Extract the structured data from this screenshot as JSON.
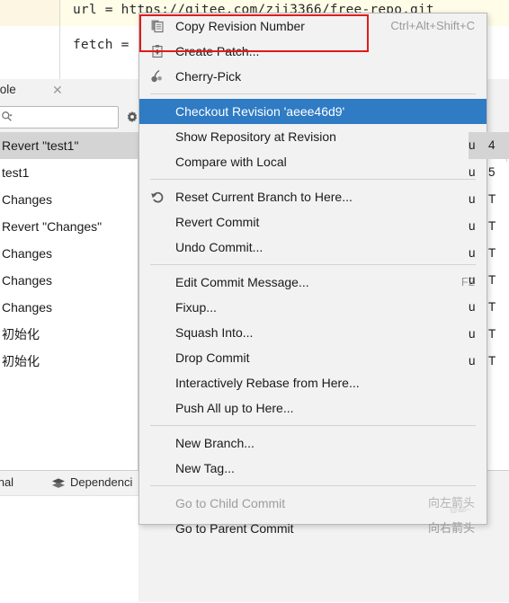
{
  "editor": {
    "line1": "url = https://gitee.com/zjj3366/free-repo.git",
    "line2": "fetch = ",
    "line2_tail": "'*"
  },
  "tool_window": {
    "tab_label": "onsole",
    "close_icon": "close-icon",
    "search": {
      "placeholder": "",
      "value": "",
      "icon": "search-icon"
    },
    "settings_icon": "gear-icon",
    "commits": [
      {
        "subject": "Revert \"test1\"",
        "selected": true
      },
      {
        "subject": "test1",
        "selected": false
      },
      {
        "subject": "Changes",
        "selected": false
      },
      {
        "subject": "Revert \"Changes\"",
        "selected": false
      },
      {
        "subject": "Changes",
        "selected": false
      },
      {
        "subject": "Changes",
        "selected": false
      },
      {
        "subject": "Changes",
        "selected": false
      },
      {
        "subject": "初始化",
        "selected": false
      },
      {
        "subject": "初始化",
        "selected": false
      }
    ],
    "right_columns": [
      {
        "author": "u",
        "date": "4",
        "selected": true
      },
      {
        "author": "u",
        "date": "5",
        "selected": false
      },
      {
        "author": "u",
        "date": "T",
        "selected": false
      },
      {
        "author": "u",
        "date": "T",
        "selected": false
      },
      {
        "author": "u",
        "date": "T",
        "selected": false
      },
      {
        "author": "u",
        "date": "T",
        "selected": false
      },
      {
        "author": "u",
        "date": "T",
        "selected": false
      },
      {
        "author": "u",
        "date": "T",
        "selected": false
      },
      {
        "author": "u",
        "date": "T",
        "selected": false
      }
    ],
    "sort_icon": "sort-arrows-icon"
  },
  "status_bar": {
    "terminal_label": "minal",
    "dependencies_label": "Dependenci",
    "dependencies_icon": "layers-icon"
  },
  "context_menu": {
    "groups": [
      {
        "items": [
          {
            "label": "Copy Revision Number",
            "accel": "Ctrl+Alt+Shift+C",
            "icon": "copy-icon",
            "state": "normal",
            "highlighted_box": true
          },
          {
            "label": "Create Patch...",
            "accel": "",
            "icon": "patch-icon",
            "state": "normal"
          },
          {
            "label": "Cherry-Pick",
            "accel": "",
            "icon": "cherry-icon",
            "state": "normal"
          }
        ]
      },
      {
        "items": [
          {
            "label": "Checkout Revision 'aeee46d9'",
            "accel": "",
            "icon": "",
            "state": "selected"
          },
          {
            "label": "Show Repository at Revision",
            "accel": "",
            "icon": "",
            "state": "normal"
          },
          {
            "label": "Compare with Local",
            "accel": "",
            "icon": "",
            "state": "normal"
          }
        ]
      },
      {
        "items": [
          {
            "label": "Reset Current Branch to Here...",
            "accel": "",
            "icon": "undo-icon",
            "state": "normal"
          },
          {
            "label": "Revert Commit",
            "accel": "",
            "icon": "",
            "state": "normal"
          },
          {
            "label": "Undo Commit...",
            "accel": "",
            "icon": "",
            "state": "normal"
          }
        ]
      },
      {
        "items": [
          {
            "label": "Edit Commit Message...",
            "accel": "F2",
            "icon": "",
            "state": "normal"
          },
          {
            "label": "Fixup...",
            "accel": "",
            "icon": "",
            "state": "normal"
          },
          {
            "label": "Squash Into...",
            "accel": "",
            "icon": "",
            "state": "normal"
          },
          {
            "label": "Drop Commit",
            "accel": "",
            "icon": "",
            "state": "normal"
          },
          {
            "label": "Interactively Rebase from Here...",
            "accel": "",
            "icon": "",
            "state": "normal"
          },
          {
            "label": "Push All up to Here...",
            "accel": "",
            "icon": "",
            "state": "normal"
          }
        ]
      },
      {
        "items": [
          {
            "label": "New Branch...",
            "accel": "",
            "icon": "",
            "state": "normal"
          },
          {
            "label": "New Tag...",
            "accel": "",
            "icon": "",
            "state": "normal"
          }
        ]
      },
      {
        "items": [
          {
            "label": "Go to Child Commit",
            "accel": "向左箭头",
            "icon": "",
            "state": "disabled"
          },
          {
            "label": "Go to Parent Commit",
            "accel": "向右箭头",
            "icon": "",
            "state": "normal"
          }
        ]
      }
    ]
  },
  "annotation": {
    "color": "#e01b1b",
    "target": "Copy Revision Number"
  },
  "watermark": {
    "text": "@all~"
  },
  "colors": {
    "menu_bg": "#f2f2f2",
    "menu_highlight": "#2f7bc4",
    "row_selected": "#d4d4d4",
    "editor_highlight": "#fffce8",
    "annotation_red": "#e01b1b"
  }
}
